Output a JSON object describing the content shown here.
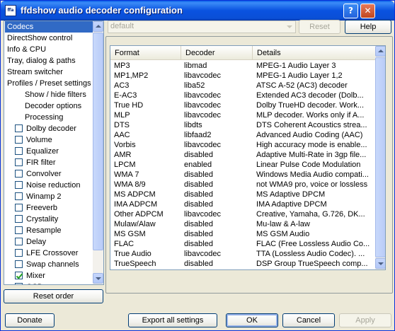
{
  "window": {
    "title": "ffdshow audio decoder configuration",
    "icon_text": "ffa"
  },
  "titlebar": {
    "help_glyph": "?",
    "close_glyph": "✕"
  },
  "tree": {
    "items": [
      {
        "label": "Codecs",
        "kind": "top",
        "selected": true
      },
      {
        "label": "DirectShow control",
        "kind": "top"
      },
      {
        "label": "Info & CPU",
        "kind": "top"
      },
      {
        "label": "Tray, dialog & paths",
        "kind": "top"
      },
      {
        "label": "Stream switcher",
        "kind": "top"
      },
      {
        "label": "Profiles / Preset settings",
        "kind": "top"
      },
      {
        "label": "Show / hide filters",
        "kind": "child"
      },
      {
        "label": "Decoder options",
        "kind": "child"
      },
      {
        "label": "Processing",
        "kind": "child"
      },
      {
        "label": "Dolby decoder",
        "kind": "check",
        "checked": false
      },
      {
        "label": "Volume",
        "kind": "check",
        "checked": false
      },
      {
        "label": "Equalizer",
        "kind": "check",
        "checked": false
      },
      {
        "label": "FIR filter",
        "kind": "check",
        "checked": false
      },
      {
        "label": "Convolver",
        "kind": "check",
        "checked": false
      },
      {
        "label": "Noise reduction",
        "kind": "check",
        "checked": false
      },
      {
        "label": "Winamp 2",
        "kind": "check",
        "checked": false
      },
      {
        "label": "Freeverb",
        "kind": "check",
        "checked": false
      },
      {
        "label": "Crystality",
        "kind": "check",
        "checked": false
      },
      {
        "label": "Resample",
        "kind": "check",
        "checked": false
      },
      {
        "label": "Delay",
        "kind": "check",
        "checked": false
      },
      {
        "label": "LFE Crossover",
        "kind": "check",
        "checked": false
      },
      {
        "label": "Swap channels",
        "kind": "check",
        "checked": false
      },
      {
        "label": "Mixer",
        "kind": "check",
        "checked": true
      },
      {
        "label": "OSD",
        "kind": "check",
        "checked": false
      }
    ]
  },
  "preset": {
    "value": "default",
    "reset_label": "Reset",
    "help_label": "Help"
  },
  "codecs": {
    "columns": [
      "Format",
      "Decoder",
      "Details"
    ],
    "rows": [
      [
        "MP3",
        "libmad",
        "MPEG-1 Audio Layer 3"
      ],
      [
        "MP1,MP2",
        "libavcodec",
        "MPEG-1 Audio Layer 1,2"
      ],
      [
        "AC3",
        "liba52",
        "ATSC A-52 (AC3) decoder"
      ],
      [
        "E-AC3",
        "libavcodec",
        "Extended AC3 decoder (Dolb..."
      ],
      [
        "True HD",
        "libavcodec",
        "Dolby TrueHD decoder. Work..."
      ],
      [
        "MLP",
        "libavcodec",
        "MLP decoder. Works only if A..."
      ],
      [
        "DTS",
        "libdts",
        "DTS Coherent Acoustics strea..."
      ],
      [
        "AAC",
        "libfaad2",
        "Advanced Audio Coding (AAC)"
      ],
      [
        "Vorbis",
        "libavcodec",
        "High accuracy mode is enable..."
      ],
      [
        "AMR",
        "disabled",
        "Adaptive Multi-Rate in 3gp file..."
      ],
      [
        "LPCM",
        "enabled",
        "Linear Pulse Code Modulation"
      ],
      [
        "WMA 7",
        "disabled",
        "Windows Media Audio compati..."
      ],
      [
        "WMA 8/9",
        "disabled",
        "not WMA9 pro, voice or lossless"
      ],
      [
        "MS ADPCM",
        "disabled",
        "MS Adaptive DPCM"
      ],
      [
        "IMA ADPCM",
        "disabled",
        "IMA Adaptive DPCM"
      ],
      [
        "Other ADPCM",
        "libavcodec",
        "Creative, Yamaha, G.726, DK..."
      ],
      [
        "Mulaw/Alaw",
        "disabled",
        "Mu-law & A-law"
      ],
      [
        "MS GSM",
        "disabled",
        "MS GSM Audio"
      ],
      [
        "FLAC",
        "disabled",
        "FLAC (Free Lossless Audio Co..."
      ],
      [
        "True Audio",
        "libavcodec",
        "TTA (Lossless Audio Codec). ..."
      ],
      [
        "TrueSpeech",
        "disabled",
        "DSP Group TrueSpeech comp..."
      ]
    ]
  },
  "buttons": {
    "reset_order": "Reset order",
    "donate": "Donate",
    "export": "Export all settings",
    "ok": "OK",
    "cancel": "Cancel",
    "apply": "Apply"
  }
}
